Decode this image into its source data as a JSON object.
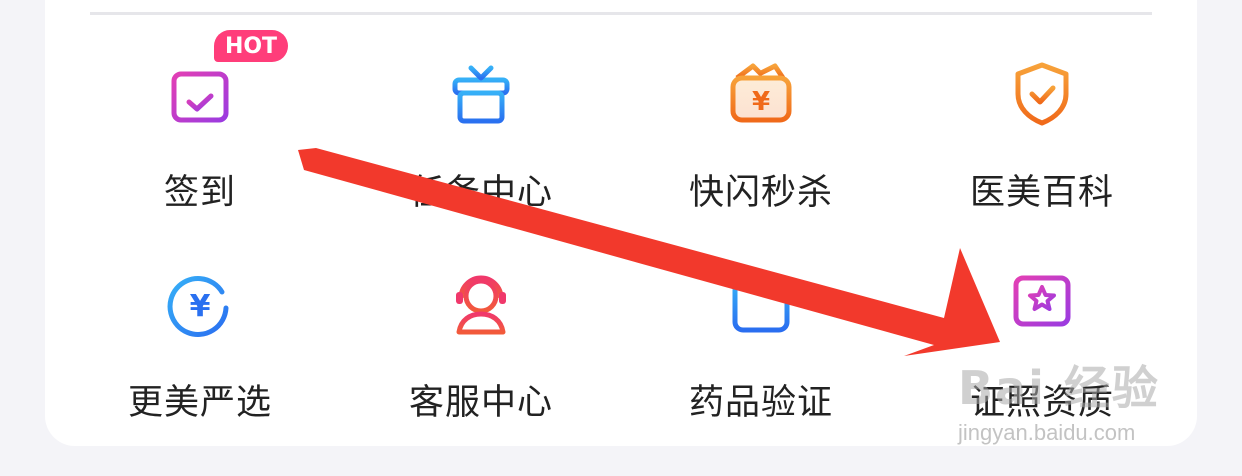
{
  "badges": {
    "hot": "HOT"
  },
  "grid": {
    "items": [
      {
        "label": "签到",
        "icon": "calendar-check-icon",
        "color": "#c23bd4"
      },
      {
        "label": "任务中心",
        "icon": "gift-box-icon",
        "color": "#2a8ef5"
      },
      {
        "label": "快闪秒杀",
        "icon": "yuan-wallet-icon",
        "color": "#f27b1e"
      },
      {
        "label": "医美百科",
        "icon": "shield-check-icon",
        "color": "#f27b1e"
      },
      {
        "label": "更美严选",
        "icon": "yuan-circle-icon",
        "color": "#2a7af5"
      },
      {
        "label": "客服中心",
        "icon": "headset-person-icon",
        "color": "#f0386b"
      },
      {
        "label": "药品验证",
        "icon": "medical-plus-icon",
        "color": "#2a7af5"
      },
      {
        "label": "证照资质",
        "icon": "certificate-star-icon",
        "color": "#c23bd4"
      }
    ]
  },
  "annotation": {
    "arrow_color": "#f2392c"
  },
  "watermark": {
    "text": "Bai 经验",
    "url": "jingyan.baidu.com"
  }
}
